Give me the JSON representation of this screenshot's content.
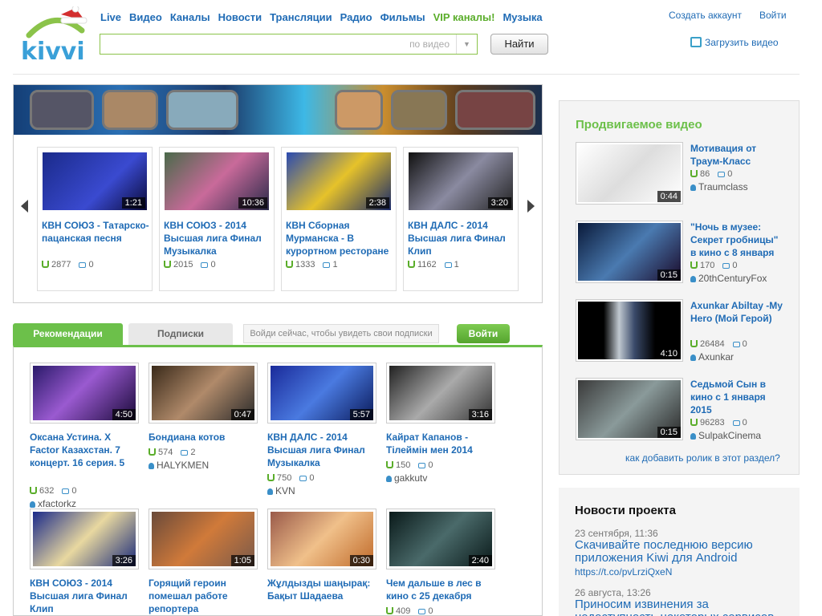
{
  "logo": {
    "text": "kivvi"
  },
  "nav": [
    "Live",
    "Видео",
    "Каналы",
    "Новости",
    "Трансляции",
    "Радио",
    "Фильмы",
    "VIP каналы!",
    "Музыка"
  ],
  "search": {
    "placeholder": "по видео",
    "button": "Найти"
  },
  "account": {
    "create": "Создать аккаунт",
    "login": "Войти",
    "upload": "Загрузить видео"
  },
  "carousel": [
    {
      "title": "КВН СОЮЗ - Татарско-пацанская песня",
      "duration": "1:21",
      "views": "2877",
      "comments": "0"
    },
    {
      "title": "КВН СОЮЗ - 2014 Высшая лига Финал Музыкалка",
      "duration": "10:36",
      "views": "2015",
      "comments": "0"
    },
    {
      "title": "КВН Сборная Мурманска - В курортном ресторане",
      "duration": "2:38",
      "views": "1333",
      "comments": "1"
    },
    {
      "title": "КВН ДАЛС - 2014 Высшая лига Финал Клип",
      "duration": "3:20",
      "views": "1162",
      "comments": "1"
    }
  ],
  "tabs": {
    "recommend": "Рекомендации",
    "subscriptions": "Подписки",
    "hint": "Войди сейчас, чтобы увидеть свои подписки",
    "login_button": "Войти"
  },
  "recommended": [
    {
      "title": "Оксана Устина. X Factor Казахстан. 7 концерт. 16 серия. 5",
      "duration": "4:50",
      "views": "632",
      "comments": "0",
      "author": "xfactorkz"
    },
    {
      "title": "Бондиана котов",
      "duration": "0:47",
      "views": "574",
      "comments": "2",
      "author": "HALYKMEN"
    },
    {
      "title": "КВН ДАЛС - 2014 Высшая лига Финал Музыкалка",
      "duration": "5:57",
      "views": "750",
      "comments": "0",
      "author": "KVN"
    },
    {
      "title": "Кайрат Капанов - Тілеймін мен 2014",
      "duration": "3:16",
      "views": "150",
      "comments": "0",
      "author": "gakkutv"
    },
    {
      "title": "КВН СОЮЗ - 2014 Высшая лига Финал Клип",
      "duration": "3:26",
      "views": "",
      "comments": "",
      "author": ""
    },
    {
      "title": "Горящий героин помешал работе репортера",
      "duration": "1:05",
      "views": "",
      "comments": "",
      "author": ""
    },
    {
      "title": "Жұлдызды шаңырақ: Бақыт Шадаева",
      "duration": "0:30",
      "views": "",
      "comments": "",
      "author": ""
    },
    {
      "title": "Чем дальше в лес в кино с 25 декабря",
      "duration": "2:40",
      "views": "409",
      "comments": "0",
      "author": ""
    }
  ],
  "promo": {
    "heading": "Продвигаемое видео",
    "items": [
      {
        "title": "Мотивация от Траум-Класс",
        "duration": "0:44",
        "views": "86",
        "comments": "0",
        "author": "Traumclass"
      },
      {
        "title": "\"Ночь в музее: Секрет гробницы\" в кино с 8 января",
        "duration": "0:15",
        "views": "170",
        "comments": "0",
        "author": "20thCenturyFox"
      },
      {
        "title": "Axunkar Abiltay -My Hero (Мой Герой)",
        "duration": "4:10",
        "views": "26484",
        "comments": "0",
        "author": "Axunkar"
      },
      {
        "title": "Седьмой Сын в кино с 1 января 2015",
        "duration": "0:15",
        "views": "96283",
        "comments": "0",
        "author": "SulpakCinema"
      }
    ],
    "how_add": "как добавить ролик в этот раздел?"
  },
  "news": {
    "heading": "Новости проекта",
    "items": [
      {
        "date": "23 сентября, 11:36",
        "title": "Скачивайте последнюю версию приложения Kiwi для Android",
        "url": "https://t.co/pvLrziQxeN"
      },
      {
        "date": "26 августа, 13:26",
        "title": "Приносим извинения за недоступность некоторых сервисов. Ведутся"
      }
    ]
  },
  "colors": {
    "accent_green": "#6cc04a",
    "link_blue": "#1f6bb5"
  }
}
